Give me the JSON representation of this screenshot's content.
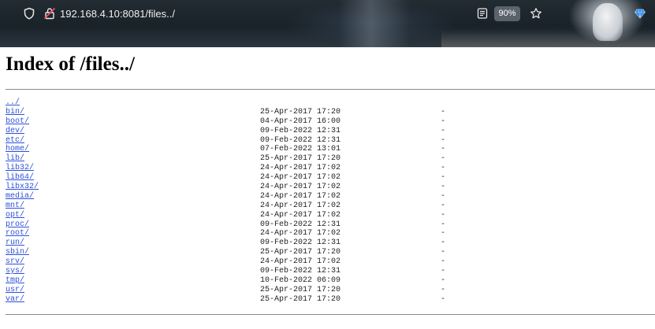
{
  "browser": {
    "url": "192.168.4.10:8081/files../",
    "zoom": "90%",
    "icons": [
      "shield-icon",
      "insecure-lock-icon",
      "reader-view-icon",
      "bookmark-star-icon",
      "extension-gem-icon"
    ]
  },
  "page": {
    "title": "Index of /files../"
  },
  "entries": [
    {
      "name": "../",
      "date": "",
      "size": ""
    },
    {
      "name": "bin/",
      "date": "25-Apr-2017 17:20",
      "size": "-"
    },
    {
      "name": "boot/",
      "date": "04-Apr-2017 16:00",
      "size": "-"
    },
    {
      "name": "dev/",
      "date": "09-Feb-2022 12:31",
      "size": "-"
    },
    {
      "name": "etc/",
      "date": "09-Feb-2022 12:31",
      "size": "-"
    },
    {
      "name": "home/",
      "date": "07-Feb-2022 13:01",
      "size": "-"
    },
    {
      "name": "lib/",
      "date": "25-Apr-2017 17:20",
      "size": "-"
    },
    {
      "name": "lib32/",
      "date": "24-Apr-2017 17:02",
      "size": "-"
    },
    {
      "name": "lib64/",
      "date": "24-Apr-2017 17:02",
      "size": "-"
    },
    {
      "name": "libx32/",
      "date": "24-Apr-2017 17:02",
      "size": "-"
    },
    {
      "name": "media/",
      "date": "24-Apr-2017 17:02",
      "size": "-"
    },
    {
      "name": "mnt/",
      "date": "24-Apr-2017 17:02",
      "size": "-"
    },
    {
      "name": "opt/",
      "date": "24-Apr-2017 17:02",
      "size": "-"
    },
    {
      "name": "proc/",
      "date": "09-Feb-2022 12:31",
      "size": "-"
    },
    {
      "name": "root/",
      "date": "24-Apr-2017 17:02",
      "size": "-"
    },
    {
      "name": "run/",
      "date": "09-Feb-2022 12:31",
      "size": "-"
    },
    {
      "name": "sbin/",
      "date": "25-Apr-2017 17:20",
      "size": "-"
    },
    {
      "name": "srv/",
      "date": "24-Apr-2017 17:02",
      "size": "-"
    },
    {
      "name": "sys/",
      "date": "09-Feb-2022 12:31",
      "size": "-"
    },
    {
      "name": "tmp/",
      "date": "10-Feb-2022 06:09",
      "size": "-"
    },
    {
      "name": "usr/",
      "date": "25-Apr-2017 17:20",
      "size": "-"
    },
    {
      "name": "var/",
      "date": "25-Apr-2017 17:20",
      "size": "-"
    }
  ],
  "colors": {
    "link": "#2d4fd7",
    "text": "#222222",
    "toolbar_dark": "#1a2229"
  }
}
